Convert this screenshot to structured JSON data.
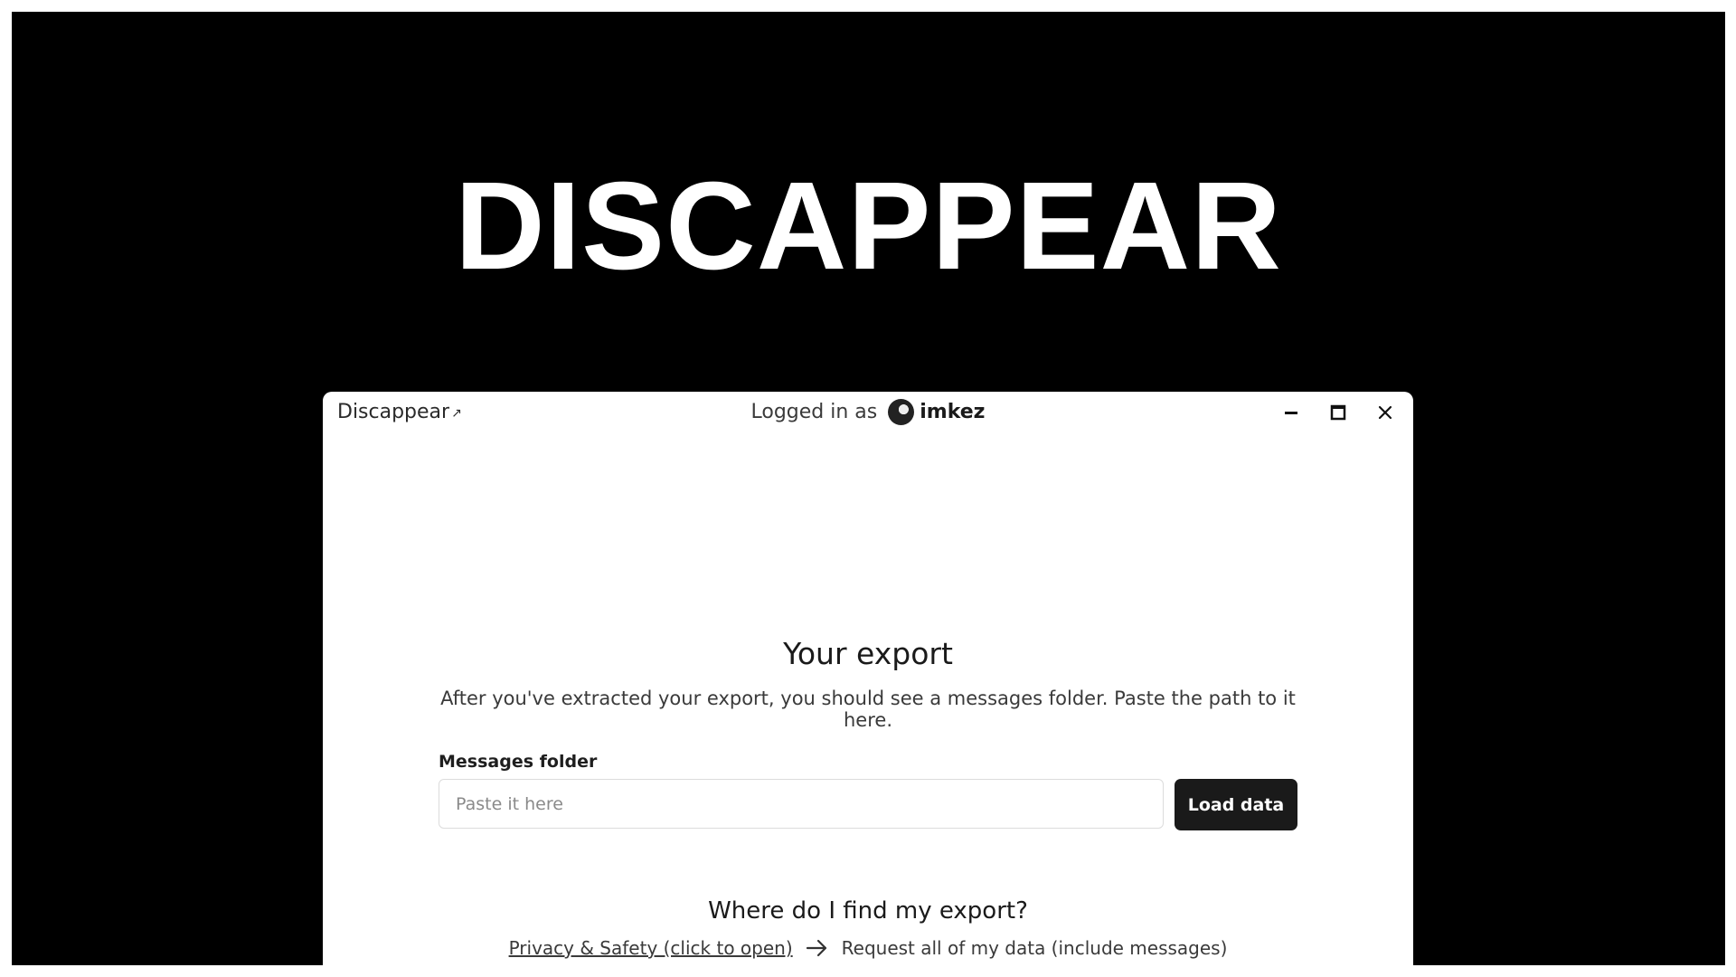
{
  "hero": {
    "title": "DISCAPPEAR"
  },
  "titlebar": {
    "app_name": "Discappear",
    "external_icon": "↗",
    "logged_in_prefix": "Logged in as",
    "username": "imkez"
  },
  "window_controls": {
    "minimize": "minimize-icon",
    "maximize": "maximize-icon",
    "close": "close-icon"
  },
  "main": {
    "heading": "Your export",
    "description": "After you've extracted your export, you should see a messages folder. Paste the path to it here.",
    "field_label": "Messages folder",
    "input_placeholder": "Paste it here",
    "input_value": "",
    "load_button": "Load data"
  },
  "help": {
    "heading": "Where do I find my export?",
    "step1": "Privacy & Safety (click to open)",
    "arrow_icon": "arrow-right-icon",
    "step2": "Request all of my data (include messages)"
  },
  "colors": {
    "background": "#000000",
    "window": "#ffffff",
    "button": "#1a1a1a"
  }
}
